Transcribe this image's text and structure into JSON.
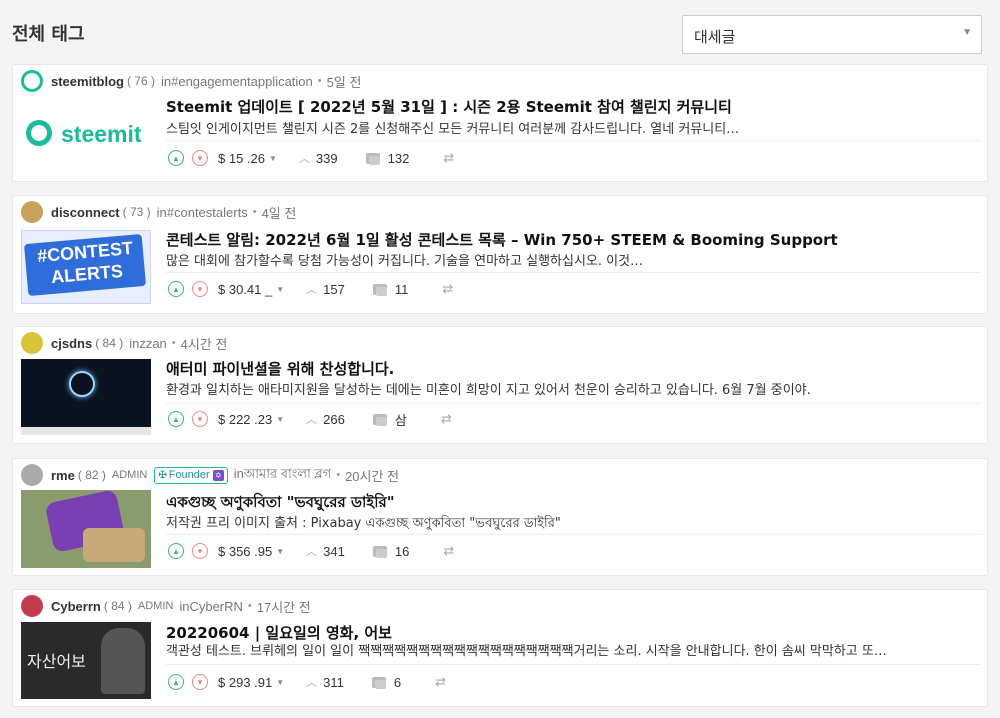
{
  "header": {
    "title": "전체 태그",
    "sort": {
      "value": "대세글"
    }
  },
  "posts": [
    {
      "author": "steemitblog",
      "rep": "( 76 )",
      "role": "",
      "founder": "",
      "category": "in#engagementapplication",
      "time": "5일 전",
      "title": "Steemit 업데이트 [ 2022년 5월 31일 ] : 시즌 2용 Steemit 참여 챌린지 커뮤니티",
      "summary": "스팀잇 인게이지먼트 챌린지 시즌 2를 신청해주신 모든 커뮤니티 여러분께 감사드립니다. 열네 커뮤니티…",
      "payout": "$ 15 .26",
      "votes": "339",
      "comments": "132",
      "thumb_text": "steemit",
      "avatar_color": "#1abc9c"
    },
    {
      "author": "disconnect",
      "rep": "( 73 )",
      "role": "",
      "founder": "",
      "category": "in#contestalerts",
      "time": "4일 전",
      "title": "콘테스트 알림: 2022년 6월 1일 활성 콘테스트 목록 – Win 750+ STEEM & Booming Support",
      "summary": "많은 대회에 참가할수록 당첨 가능성이 커집니다. 기술을 연마하고 실행하십시오. 이것…",
      "payout": "$ 30.41 _",
      "votes": "157",
      "comments": "11",
      "thumb_text": "#CONTEST ALERTS",
      "avatar_color": "#c9a25a"
    },
    {
      "author": "cjsdns",
      "rep": "( 84 )",
      "role": "",
      "founder": "",
      "category": "inzzan",
      "time": "4시간 전",
      "title": "애터미 파이낸셜을 위해 찬성합니다.",
      "summary": "환경과 일치하는 애타미지원을 달성하는 데에는 미혼이 희망이 지고 있어서 천운이 승리하고 있습니다. 6월 7월 중이야.",
      "payout": "$ 222 .23",
      "votes": "266",
      "comments": "삼",
      "thumb_text": "",
      "avatar_color": "#d8c43a"
    },
    {
      "author": "rme",
      "rep": "( 82 )",
      "role": "ADMIN",
      "founder": "Founder",
      "category": "inআমার বাংলা ব্লগ",
      "time": "20시간 전",
      "title": "একগুচ্ছ অণুকবিতা \"ভবঘুরের ডাইরি\"",
      "summary": "저작권 프리 이미지 출처 : Pixabay একগুচ্ছ অণুকবিতা \"ভবঘুরের ডাইরি\"",
      "payout": "$ 356 .95",
      "votes": "341",
      "comments": "16",
      "thumb_text": "",
      "avatar_color": "#999999"
    },
    {
      "author": "Cyberrn",
      "rep": "( 84 )",
      "role": "ADMIN",
      "founder": "",
      "category": "inCyberRN",
      "time": "17시간 전",
      "title": "20220604 | 일요일의 영화, 어보",
      "summary": "객관성 테스트. 브뤼헤의 일이 일이 짹짹짹짹짹짹짹짹짹짹짹짹짹짹짹짹짹짹거리는 소리. 시작을 안내합니다. 한이 솜씨 막막하고 또…",
      "payout": "$ 293 .91",
      "votes": "311",
      "comments": "6",
      "thumb_text": "자산어보",
      "avatar_color": "#c23b4f"
    }
  ]
}
